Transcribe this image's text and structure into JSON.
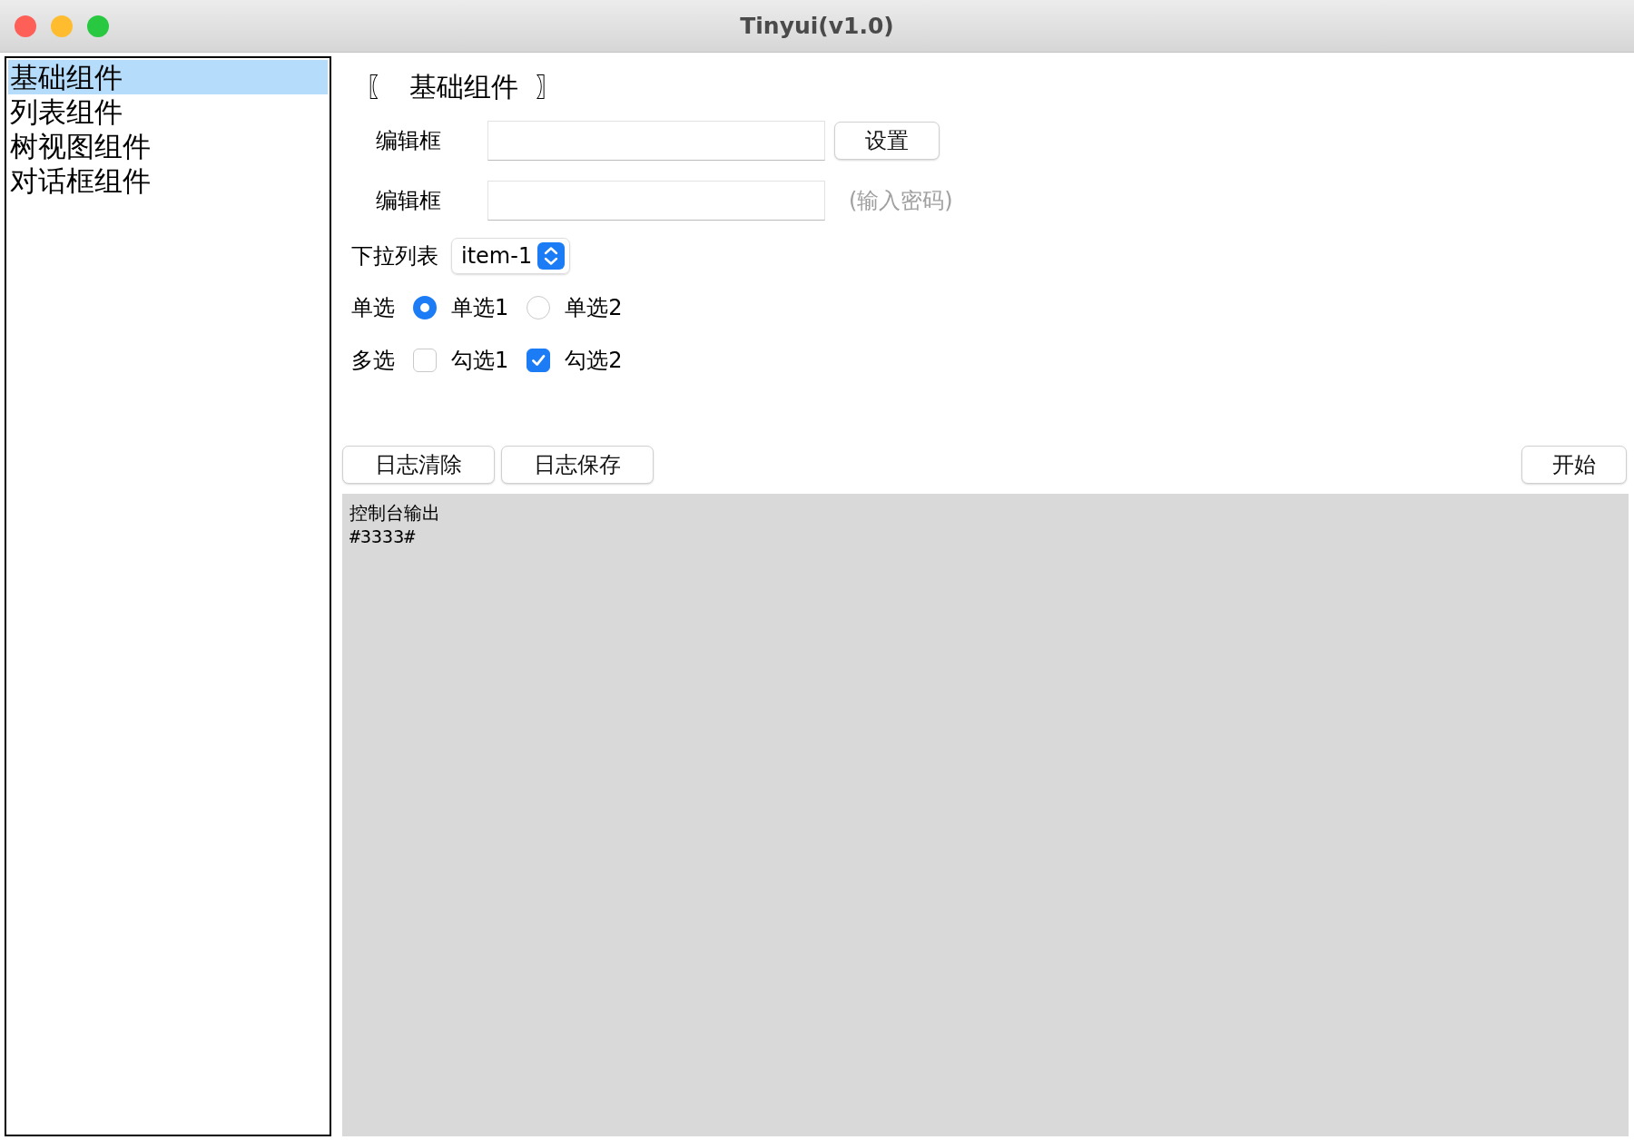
{
  "window": {
    "title": "Tinyui(v1.0)"
  },
  "sidebar": {
    "items": [
      {
        "label": "基础组件",
        "selected": true
      },
      {
        "label": "列表组件",
        "selected": false
      },
      {
        "label": "树视图组件",
        "selected": false
      },
      {
        "label": "对话框组件",
        "selected": false
      }
    ]
  },
  "header": "〖  基础组件  〗",
  "fields": [
    {
      "label": "编辑框",
      "button": "设置"
    },
    {
      "label": "编辑框",
      "hint": "(输入密码)"
    }
  ],
  "dropdown": {
    "label": "下拉列表",
    "value": "item-1"
  },
  "radio_group": {
    "label": "单选",
    "options": [
      {
        "label": "单选1",
        "selected": true
      },
      {
        "label": "单选2",
        "selected": false
      }
    ]
  },
  "checkbox_group": {
    "label": "多选",
    "options": [
      {
        "label": "勾选1",
        "checked": false
      },
      {
        "label": "勾选2",
        "checked": true
      }
    ]
  },
  "log_buttons": [
    "日志清除",
    "日志保存"
  ],
  "start_button": "开始",
  "console": {
    "lines": [
      "控制台输出",
      "#3333#"
    ]
  }
}
